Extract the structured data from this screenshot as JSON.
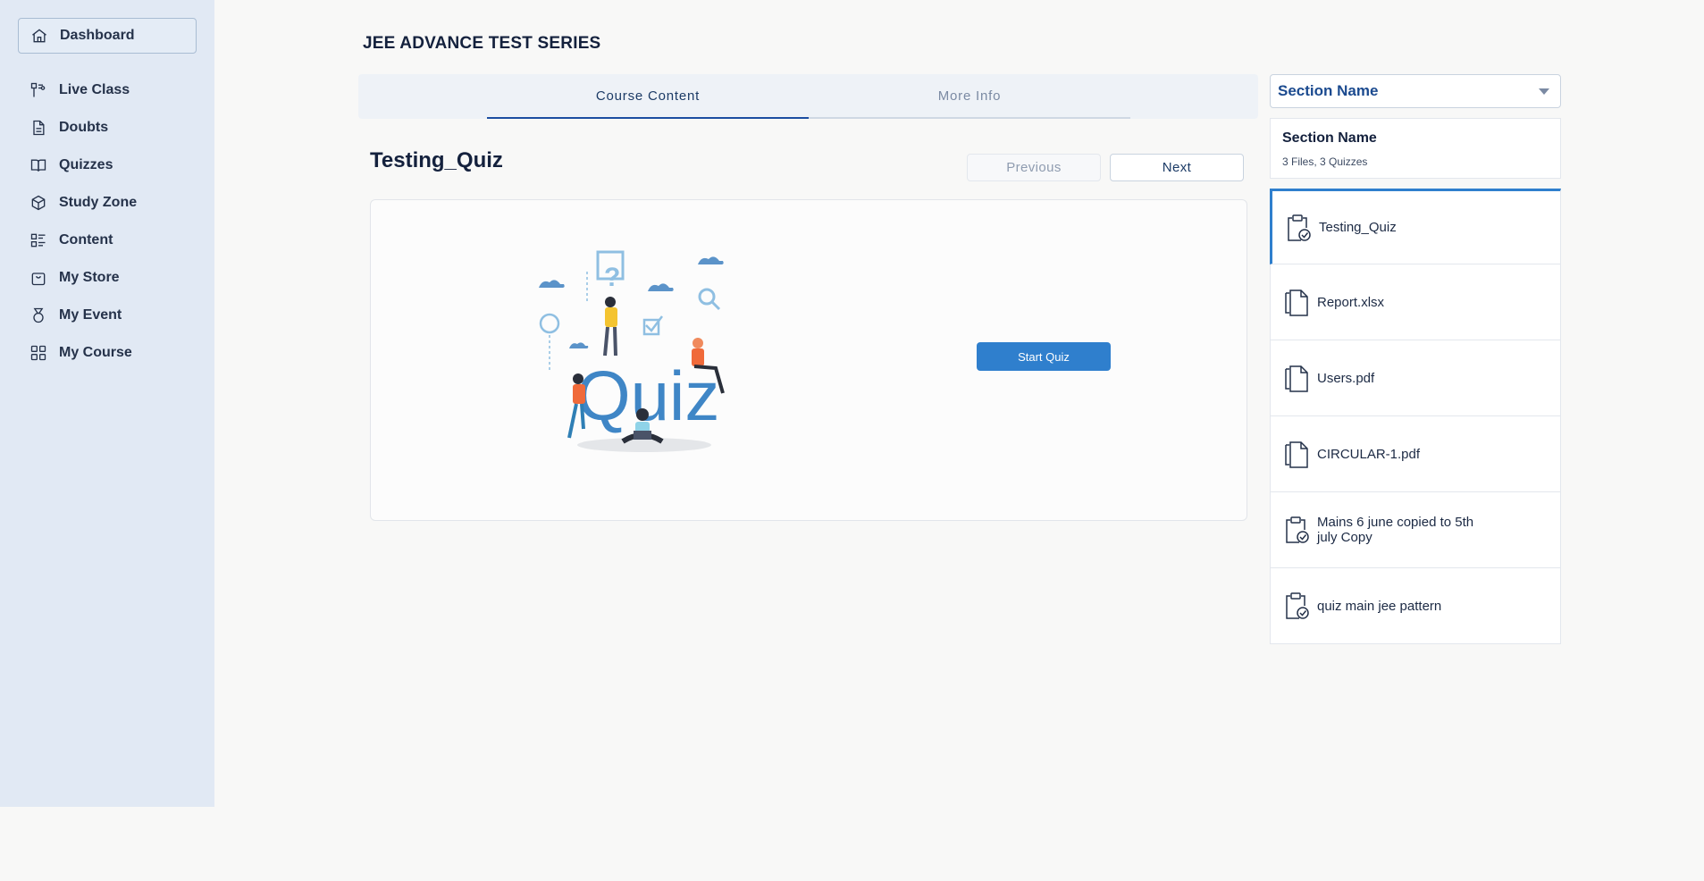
{
  "sidebar": {
    "items": [
      {
        "label": "Dashboard",
        "icon": "home-icon"
      },
      {
        "label": "Live Class",
        "icon": "broadcast-icon"
      },
      {
        "label": "Doubts",
        "icon": "document-icon"
      },
      {
        "label": "Quizzes",
        "icon": "book-icon"
      },
      {
        "label": "Study Zone",
        "icon": "cube-icon"
      },
      {
        "label": "Content",
        "icon": "list-icon"
      },
      {
        "label": "My Store",
        "icon": "bag-icon"
      },
      {
        "label": "My Event",
        "icon": "medal-icon"
      },
      {
        "label": "My Course",
        "icon": "grid-icon"
      }
    ]
  },
  "header": {
    "title": "JEE ADVANCE TEST SERIES"
  },
  "tabs": [
    {
      "label": "Course Content",
      "active": true
    },
    {
      "label": "More Info",
      "active": false
    }
  ],
  "content": {
    "title": "Testing_Quiz",
    "prev_label": "Previous",
    "next_label": "Next",
    "start_label": "Start Quiz",
    "illustration_text": "Quiz"
  },
  "right_panel": {
    "select_value": "Section Name",
    "section": {
      "name": "Section Name",
      "meta": "3 Files, 3 Quizzes"
    },
    "items": [
      {
        "label": "Testing_Quiz",
        "type": "quiz",
        "icon": "clipboard-check-icon"
      },
      {
        "label": "Report.xlsx",
        "type": "file",
        "icon": "file-copy-icon"
      },
      {
        "label": "Users.pdf",
        "type": "file",
        "icon": "file-copy-icon"
      },
      {
        "label": "CIRCULAR-1.pdf",
        "type": "file",
        "icon": "file-copy-icon"
      },
      {
        "label": "Mains 6 june copied to 5th july Copy",
        "type": "quiz",
        "icon": "clipboard-check-icon"
      },
      {
        "label": "quiz main jee pattern",
        "type": "quiz",
        "icon": "clipboard-check-icon"
      }
    ]
  },
  "colors": {
    "accent": "#2f7fcd",
    "sidebar_bg": "#e1e9f4",
    "primary_text": "#14213d"
  }
}
